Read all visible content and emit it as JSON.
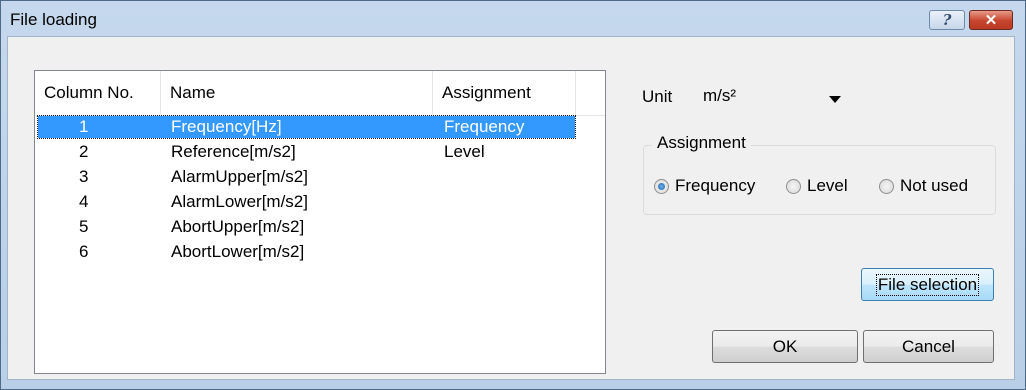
{
  "window": {
    "title": "File loading",
    "help_label": "?",
    "close_label": "✕"
  },
  "table": {
    "columns": [
      "Column No.",
      "Name",
      "Assignment"
    ],
    "rows": [
      {
        "no": "1",
        "name": "Frequency[Hz]",
        "assignment": "Frequency",
        "selected": true
      },
      {
        "no": "2",
        "name": "Reference[m/s2]",
        "assignment": "Level"
      },
      {
        "no": "3",
        "name": "AlarmUpper[m/s2]",
        "assignment": ""
      },
      {
        "no": "4",
        "name": "AlarmLower[m/s2]",
        "assignment": ""
      },
      {
        "no": "5",
        "name": "AbortUpper[m/s2]",
        "assignment": ""
      },
      {
        "no": "6",
        "name": "AbortLower[m/s2]",
        "assignment": ""
      }
    ]
  },
  "unit": {
    "label": "Unit",
    "value": "m/s²"
  },
  "assignment_group": {
    "label": "Assignment",
    "options": [
      {
        "label": "Frequency",
        "checked": true
      },
      {
        "label": "Level",
        "checked": false
      },
      {
        "label": "Not used",
        "checked": false
      }
    ]
  },
  "buttons": {
    "file_selection": "File selection",
    "ok": "OK",
    "cancel": "Cancel"
  }
}
